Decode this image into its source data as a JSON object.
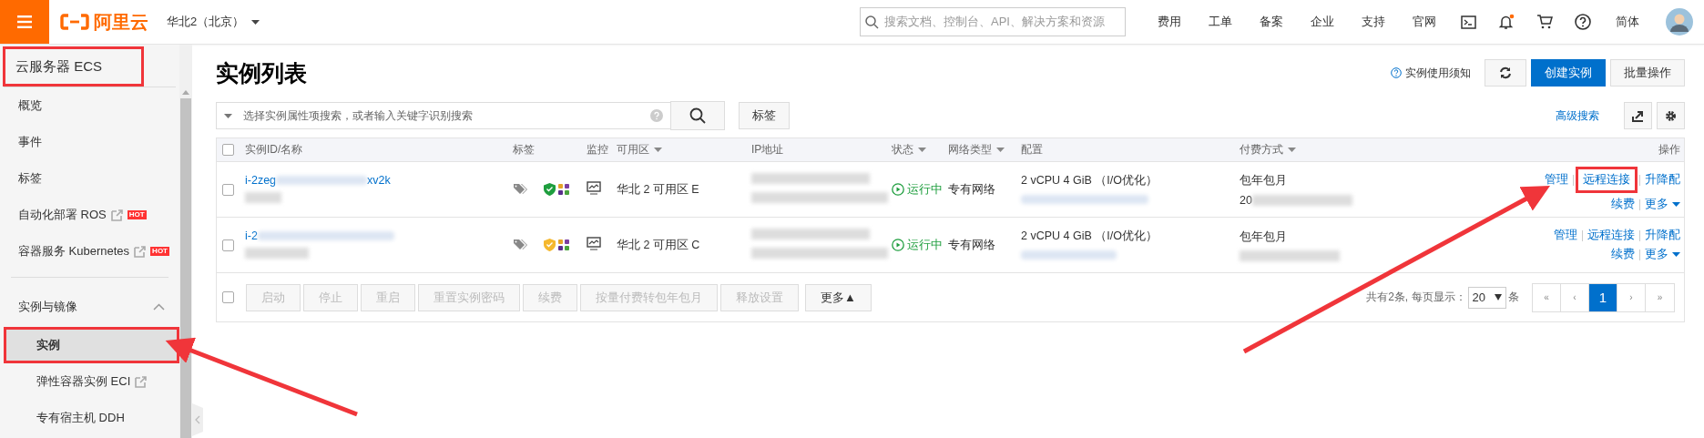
{
  "topbar": {
    "region": "华北2（北京）",
    "search": {
      "placeholder": "搜索文档、控制台、API、解决方案和资源"
    },
    "nav": [
      "费用",
      "工单",
      "备案",
      "企业",
      "支持",
      "官网"
    ],
    "language": "简体",
    "logo": "阿里云"
  },
  "sidebar": {
    "title": {
      "label": "云服务器 ECS",
      "highlighted": true
    },
    "items": [
      {
        "label": "概览",
        "external": false
      },
      {
        "label": "事件",
        "external": false
      },
      {
        "label": "标签",
        "external": false
      },
      {
        "label": "自动化部署 ROS",
        "external": true,
        "badge": "HOT"
      },
      {
        "label": "容器服务 Kubernetes",
        "external": true,
        "badge": "HOT"
      }
    ],
    "groups": [
      {
        "label": "实例与镜像",
        "expanded": true,
        "children": [
          {
            "label": "实例",
            "selected": true,
            "highlighted": true,
            "external": false
          },
          {
            "label": "弹性容器实例 ECI",
            "selected": false,
            "highlighted": false,
            "external": true
          },
          {
            "label": "专有宿主机 DDH",
            "selected": false,
            "highlighted": false,
            "external": false
          }
        ]
      }
    ]
  },
  "page": {
    "title": "实例列表",
    "help_link": "实例使用须知",
    "buttons": [
      {
        "label": "创建实例",
        "kind": "primary"
      },
      {
        "label": "批量操作",
        "kind": "default"
      }
    ],
    "search": {
      "placeholder": "选择实例属性项搜索，或者输入关键字识别搜索"
    },
    "tag_button": "标签",
    "advanced_search": "高级搜索"
  },
  "table": {
    "all_checked": false,
    "columns": [
      {
        "label": "实例ID/名称",
        "sortable": false
      },
      {
        "label": "标签",
        "sortable": false
      },
      {
        "label": "监控",
        "sortable": false
      },
      {
        "label": "可用区",
        "sortable": true
      },
      {
        "label": "IP地址",
        "sortable": false
      },
      {
        "label": "状态",
        "sortable": true
      },
      {
        "label": "网络类型",
        "sortable": true
      },
      {
        "label": "配置",
        "sortable": false
      },
      {
        "label": "付费方式",
        "sortable": true
      },
      {
        "label": "操作",
        "sortable": false
      }
    ],
    "rows": [
      {
        "checked": false,
        "id_start": "i-2zeg",
        "id_end": "xv2k",
        "color": "#1e9e3e",
        "zone": "华北 2 可用区 E",
        "status": "运行中",
        "network": "专有网络",
        "config": "2 vCPU 4 GiB （I/O优化）",
        "billing": "包年包月",
        "billing_date": "20",
        "actions": [
          {
            "label": "管理",
            "highlighted": false
          },
          {
            "label": "远程连接",
            "highlighted": true
          },
          {
            "label": "升降配",
            "highlighted": false
          },
          {
            "label": "续费",
            "highlighted": false
          },
          {
            "label": "更多",
            "highlighted": false
          }
        ]
      },
      {
        "checked": false,
        "id_start": "i-2",
        "id_end": "",
        "color": "#f5b82e",
        "zone": "华北 2 可用区 C",
        "status": "运行中",
        "network": "专有网络",
        "config": "2 vCPU 4 GiB （I/O优化）",
        "billing": "包年包月",
        "billing_date": "",
        "actions": [
          {
            "label": "管理",
            "highlighted": false
          },
          {
            "label": "远程连接",
            "highlighted": false
          },
          {
            "label": "升降配",
            "highlighted": false
          },
          {
            "label": "续费",
            "highlighted": false
          },
          {
            "label": "更多",
            "highlighted": false
          }
        ]
      }
    ],
    "footer": {
      "checked": false,
      "buttons": [
        {
          "label": "启动",
          "disabled": true
        },
        {
          "label": "停止",
          "disabled": true
        },
        {
          "label": "重启",
          "disabled": true
        },
        {
          "label": "重置实例密码",
          "disabled": true
        },
        {
          "label": "续费",
          "disabled": true
        },
        {
          "label": "按量付费转包年包月",
          "disabled": true
        },
        {
          "label": "释放设置",
          "disabled": true
        },
        {
          "label": "更多▲",
          "disabled": false
        }
      ],
      "summary": "共有2条, 每页显示：",
      "page_size": "20",
      "unit": "条",
      "pages": [
        {
          "label": "«",
          "selected": false
        },
        {
          "label": "‹",
          "selected": false
        },
        {
          "label": "1",
          "selected": true
        },
        {
          "label": "›",
          "selected": false
        },
        {
          "label": "»",
          "selected": false
        }
      ]
    }
  }
}
